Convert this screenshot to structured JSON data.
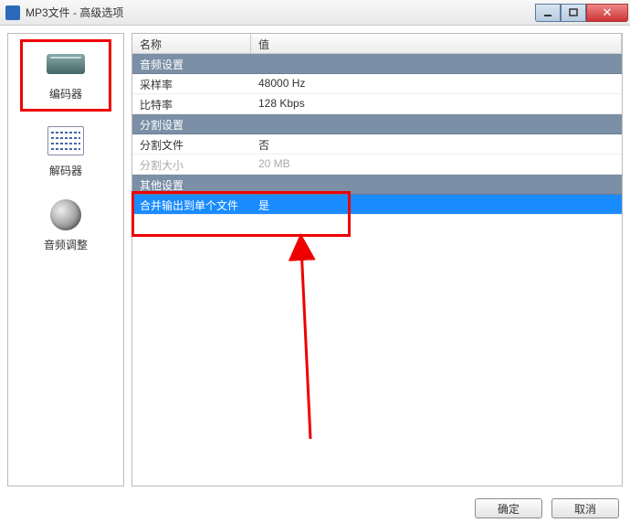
{
  "window": {
    "title": "MP3文件 - 高级选项"
  },
  "sidebar": {
    "items": [
      {
        "label": "编码器"
      },
      {
        "label": "解码器"
      },
      {
        "label": "音频调整"
      }
    ]
  },
  "table": {
    "headers": {
      "name": "名称",
      "value": "值"
    },
    "sections": [
      {
        "title": "音频设置",
        "rows": [
          {
            "name": "采样率",
            "value": "48000 Hz"
          },
          {
            "name": "比特率",
            "value": "128 Kbps"
          }
        ]
      },
      {
        "title": "分割设置",
        "rows": [
          {
            "name": "分割文件",
            "value": "否"
          },
          {
            "name": "分割大小",
            "value": "20 MB",
            "disabled": true
          }
        ]
      },
      {
        "title": "其他设置",
        "rows": [
          {
            "name": "合并输出到单个文件",
            "value": "是",
            "selected": true
          }
        ]
      }
    ]
  },
  "buttons": {
    "ok": "确定",
    "cancel": "取消"
  }
}
